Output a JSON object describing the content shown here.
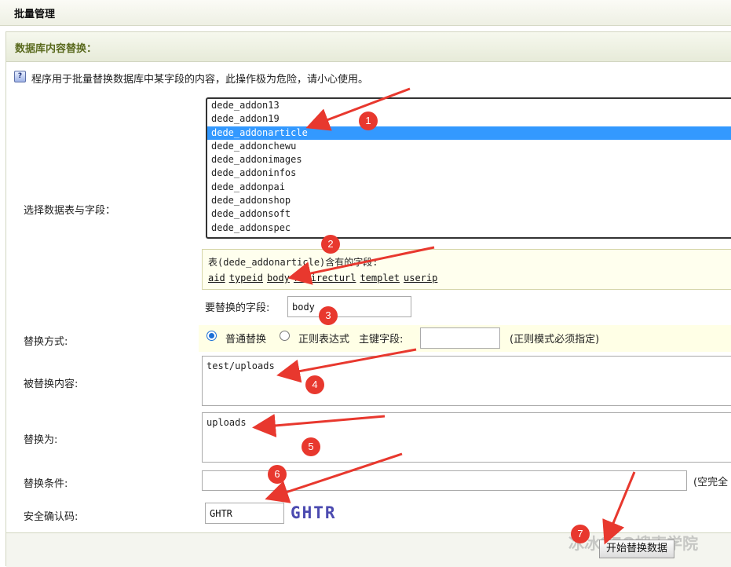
{
  "page_title": "批量管理",
  "section_title": "数据库内容替换：",
  "notice": "程序用于批量替换数据库中某字段的内容，此操作极为危险，请小心使用。",
  "select_table": {
    "label": "选择数据表与字段：",
    "options": [
      "dede_addon13",
      "dede_addon19",
      "dede_addonarticle",
      "dede_addonchewu",
      "dede_addonimages",
      "dede_addoninfos",
      "dede_addonpai",
      "dede_addonshop",
      "dede_addonsoft",
      "dede_addonspec"
    ],
    "selected": "dede_addonarticle"
  },
  "fields_box": {
    "caption": "表(dede_addonarticle)含有的字段:",
    "fields": [
      "aid",
      "typeid",
      "body",
      "redirecturl",
      "templet",
      "userip"
    ]
  },
  "replace_field": {
    "label": "要替换的字段:",
    "value": "body"
  },
  "mode": {
    "label": "替换方式:",
    "normal_label": "普通替换",
    "regex_label": "正则表达式",
    "primary_key_label": "主键字段:",
    "primary_key_value": "",
    "regex_note": "(正则模式必须指定)",
    "selected": "normal"
  },
  "replaced_content": {
    "label": "被替换内容:",
    "value": "test/uploads"
  },
  "replace_with": {
    "label": "替换为:",
    "value": "uploads"
  },
  "condition": {
    "label": "替换条件:",
    "value": "",
    "note": "(空完全"
  },
  "captcha": {
    "label": "安全确认码:",
    "value": "GHTR",
    "image_text": "GHTR"
  },
  "submit_label": "开始替换数据",
  "markers": [
    "1",
    "2",
    "3",
    "4",
    "5",
    "6",
    "7"
  ],
  "watermark": "冰冰SEO搜索学院",
  "colors": {
    "accent": "#3399ff",
    "marker": "#e8382e",
    "section_title": "#5a6a1e"
  }
}
